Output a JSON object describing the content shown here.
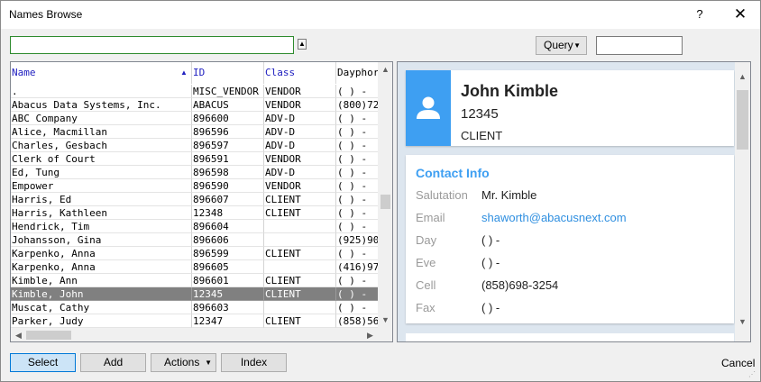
{
  "window": {
    "title": "Names Browse",
    "help_label": "?",
    "close_label": "✕"
  },
  "search": {
    "value": "",
    "collapse_label": "▲"
  },
  "query": {
    "label": "Query",
    "caret": "▼",
    "value": ""
  },
  "grid": {
    "columns": {
      "name": "Name",
      "id": "ID",
      "class": "Class",
      "dayphone": "Dayphor",
      "sort_arrow": "▲"
    },
    "rows": [
      {
        "name": ".",
        "id": "MISC_VENDOR",
        "class": "VENDOR",
        "day": "(  )  -"
      },
      {
        "name": "Abacus Data Systems, Inc.",
        "id": "ABACUS",
        "class": "VENDOR",
        "day": "(800)72"
      },
      {
        "name": "ABC Company",
        "id": "896600",
        "class": "ADV-D",
        "day": "(  )  -"
      },
      {
        "name": "Alice, Macmillan",
        "id": "896596",
        "class": "ADV-D",
        "day": "(  )  -"
      },
      {
        "name": "Charles, Gesbach",
        "id": "896597",
        "class": "ADV-D",
        "day": "(  )  -"
      },
      {
        "name": "Clerk of Court",
        "id": "896591",
        "class": "VENDOR",
        "day": "(  )  -"
      },
      {
        "name": "Ed, Tung",
        "id": "896598",
        "class": "ADV-D",
        "day": "(  )  -"
      },
      {
        "name": "Empower",
        "id": "896590",
        "class": "VENDOR",
        "day": "(  )  -"
      },
      {
        "name": "Harris, Ed",
        "id": "896607",
        "class": "CLIENT",
        "day": "(  )  -"
      },
      {
        "name": "Harris, Kathleen",
        "id": "12348",
        "class": "CLIENT",
        "day": "(  )  -"
      },
      {
        "name": "Hendrick, Tim",
        "id": "896604",
        "class": "",
        "day": "(  )  -"
      },
      {
        "name": "Johansson, Gina",
        "id": "896606",
        "class": "",
        "day": "(925)90"
      },
      {
        "name": "Karpenko, Anna",
        "id": "896599",
        "class": "CLIENT",
        "day": "(  )  -"
      },
      {
        "name": "Karpenko, Anna",
        "id": "896605",
        "class": "",
        "day": "(416)97"
      },
      {
        "name": "Kimble, Ann",
        "id": "896601",
        "class": "CLIENT",
        "day": "(  )  -"
      },
      {
        "name": "Kimble, John",
        "id": "12345",
        "class": "CLIENT",
        "day": "(  )  -",
        "selected": true
      },
      {
        "name": "Muscat, Cathy",
        "id": "896603",
        "class": "",
        "day": "(  )  -"
      },
      {
        "name": "Parker, Judy",
        "id": "12347",
        "class": "CLIENT",
        "day": "(858)56"
      }
    ]
  },
  "detail": {
    "name": "John Kimble",
    "id": "12345",
    "class": "CLIENT",
    "contact_heading": "Contact Info",
    "fields": [
      {
        "label": "Salutation",
        "value": "Mr. Kimble"
      },
      {
        "label": "Email",
        "value": "shaworth@abacusnext.com",
        "link": true
      },
      {
        "label": "Day",
        "value": "( ) -"
      },
      {
        "label": "Eve",
        "value": "( ) -"
      },
      {
        "label": "Cell",
        "value": "(858)698-3254"
      },
      {
        "label": "Fax",
        "value": "( ) -"
      }
    ]
  },
  "buttons": {
    "select": "Select",
    "add": "Add",
    "actions": "Actions",
    "actions_caret": "▼",
    "index": "Index",
    "cancel": "Cancel"
  },
  "colors": {
    "accent": "#3e9ff2",
    "selected_row": "#808080",
    "link": "#2f8fe0",
    "header_text": "#2020c0"
  },
  "icons": {
    "avatar": "person-icon",
    "close": "close-icon"
  }
}
